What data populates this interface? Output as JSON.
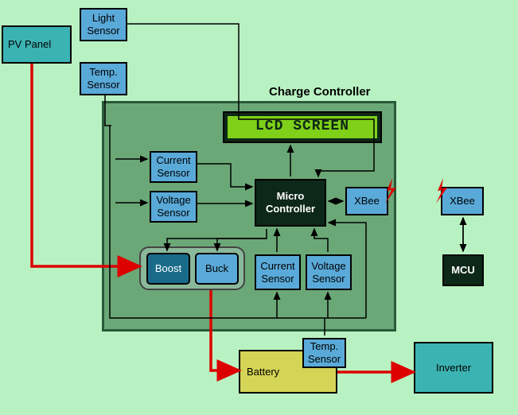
{
  "pv_panel": "PV Panel",
  "light_sensor": "Light Sensor",
  "temp_sensor_top": "Temp. Sensor",
  "charge_controller_label": "Charge Controller",
  "lcd": "LCD SCREEN",
  "current_sensor_1": "Current Sensor",
  "voltage_sensor_1": "Voltage Sensor",
  "micro": "Micro Controller",
  "xbee_1": "XBee",
  "xbee_2": "XBee",
  "mcu": "MCU",
  "boost": "Boost",
  "buck": "Buck",
  "current_sensor_2": "Current Sensor",
  "voltage_sensor_2": "Voltage Sensor",
  "battery": "Battery",
  "temp_sensor_bot": "Temp. Sensor",
  "inverter": "Inverter"
}
